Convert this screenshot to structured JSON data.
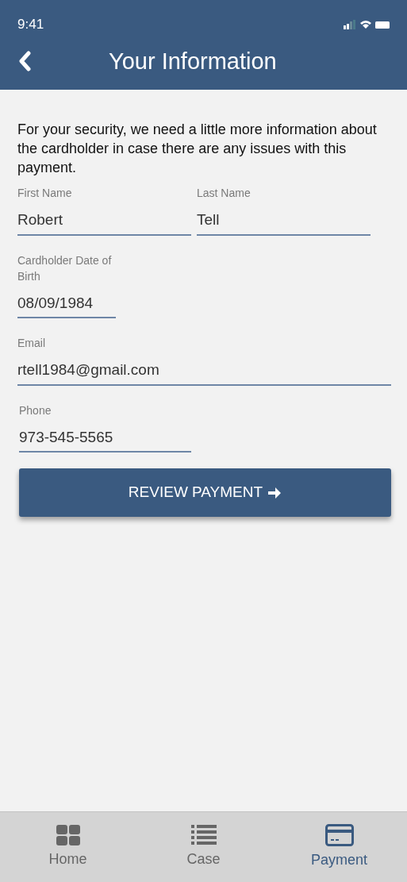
{
  "status_bar": {
    "time": "9:41"
  },
  "header": {
    "title": "Your Information"
  },
  "intro": "For your security, we need a little more information about the cardholder in case there are any issues with this payment.",
  "fields": [
    {
      "label": "First Name",
      "value": "Robert"
    },
    {
      "label": "Last Name",
      "value": "Tell"
    },
    {
      "label": "Cardholder Date of Birth",
      "value": "08/09/1984"
    },
    {
      "label": "Email",
      "value": "rtell1984@gmail.com"
    },
    {
      "label": "Phone",
      "value": "973-545-5565"
    }
  ],
  "button": {
    "label": "REVIEW PAYMENT"
  },
  "tab_bar": [
    {
      "kind": "home",
      "label": "Home",
      "selected": false
    },
    {
      "kind": "case",
      "label": "Case",
      "selected": false
    },
    {
      "kind": "payment",
      "label": "Payment",
      "selected": true
    }
  ]
}
